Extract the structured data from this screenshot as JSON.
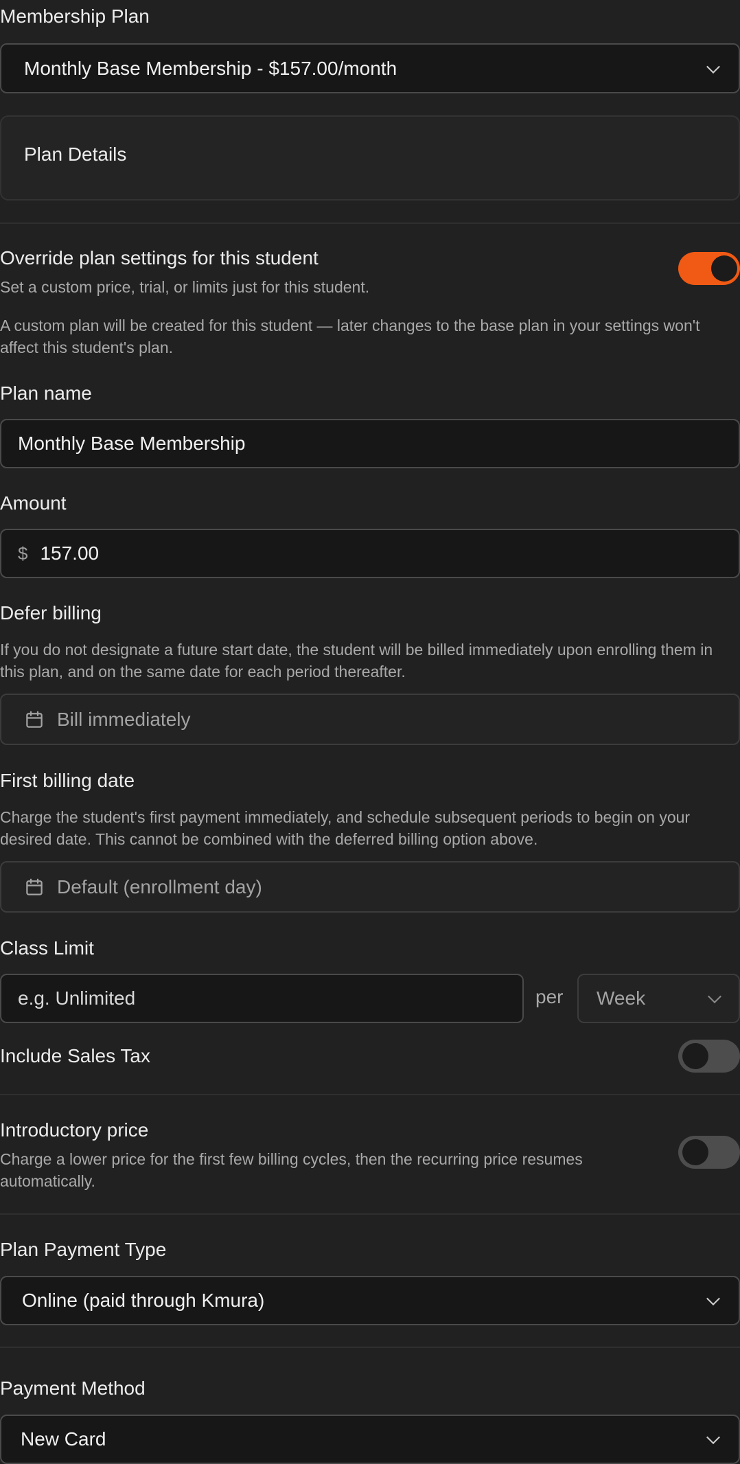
{
  "membership": {
    "label": "Membership Plan",
    "selected": "Monthly Base Membership - $157.00/month",
    "details_title": "Plan Details"
  },
  "override": {
    "title": "Override plan settings for this student",
    "subtitle": "Set a custom price, trial, or limits just for this student.",
    "enabled": true,
    "notice": "A custom plan will be created for this student — later changes to the base plan in your settings won't affect this student's plan."
  },
  "plan_name": {
    "label": "Plan name",
    "value": "Monthly Base Membership"
  },
  "amount": {
    "label": "Amount",
    "currency": "$",
    "value": "157.00"
  },
  "defer_billing": {
    "label": "Defer billing",
    "description": "If you do not designate a future start date, the student will be billed immediately upon enrolling them in this plan, and on the same date for each period thereafter.",
    "placeholder": "Bill immediately"
  },
  "first_billing": {
    "label": "First billing date",
    "description": "Charge the student's first payment immediately, and schedule subsequent periods to begin on your desired date. This cannot be combined with the deferred billing option above.",
    "placeholder": "Default (enrollment day)"
  },
  "class_limit": {
    "label": "Class Limit",
    "placeholder": "e.g. Unlimited",
    "per_label": "per",
    "period": "Week"
  },
  "sales_tax": {
    "label": "Include Sales Tax",
    "enabled": false
  },
  "intro_price": {
    "label": "Introductory price",
    "description": "Charge a lower price for the first few billing cycles, then the recurring price resumes automatically.",
    "enabled": false
  },
  "payment_type": {
    "label": "Plan Payment Type",
    "selected": "Online (paid through Kmura)"
  },
  "payment_method": {
    "label": "Payment Method",
    "selected": "New Card"
  },
  "colors": {
    "background": "#212121",
    "accent": "#f05a14",
    "field_bg": "#171717"
  }
}
